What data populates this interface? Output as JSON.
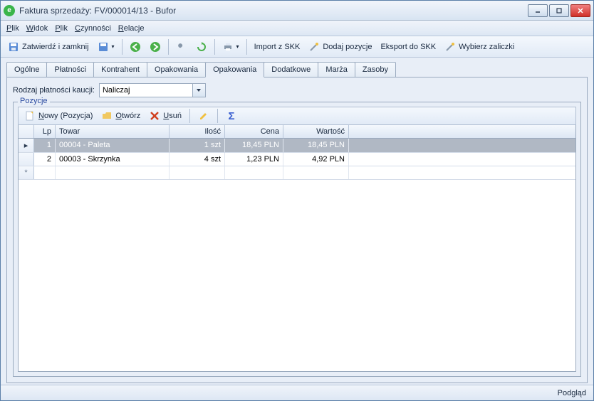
{
  "window": {
    "title": "Faktura sprzedaży: FV/000014/13 - Bufor"
  },
  "menu": {
    "plik": "Plik",
    "widok": "Widok",
    "plik2": "Plik",
    "czynnosci": "Czynności",
    "relacje": "Relacje"
  },
  "toolbar": {
    "zatwierdz": "Zatwierdź i zamknij",
    "import_skk": "Import z SKK",
    "dodaj_pozycje": "Dodaj pozycje",
    "eksport_skk": "Eksport do SKK",
    "wybierz_zaliczki": "Wybierz zaliczki"
  },
  "tabs": [
    "Ogólne",
    "Płatności",
    "Kontrahent",
    "Opakowania",
    "Opakowania",
    "Dodatkowe",
    "Marża",
    "Zasoby"
  ],
  "active_tab_index": 4,
  "form": {
    "rodzaj_label": "Rodzaj płatności kaucji:",
    "rodzaj_value": "Naliczaj",
    "pozycje_legend": "Pozycje"
  },
  "grid_toolbar": {
    "nowy": "Nowy (Pozycja)",
    "otworz": "Otwórz",
    "usun": "Usuń"
  },
  "grid": {
    "headers": {
      "lp": "Lp",
      "towar": "Towar",
      "ilosc": "Ilość",
      "cena": "Cena",
      "wartosc": "Wartość"
    },
    "rows": [
      {
        "lp": "1",
        "towar": "00004 - Paleta",
        "ilosc": "1 szt",
        "cena": "18,45 PLN",
        "wartosc": "18,45 PLN",
        "selected": true
      },
      {
        "lp": "2",
        "towar": "00003 - Skrzynka",
        "ilosc": "4 szt",
        "cena": "1,23 PLN",
        "wartosc": "4,92 PLN",
        "selected": false
      }
    ]
  },
  "status": {
    "podglad": "Podgląd"
  }
}
